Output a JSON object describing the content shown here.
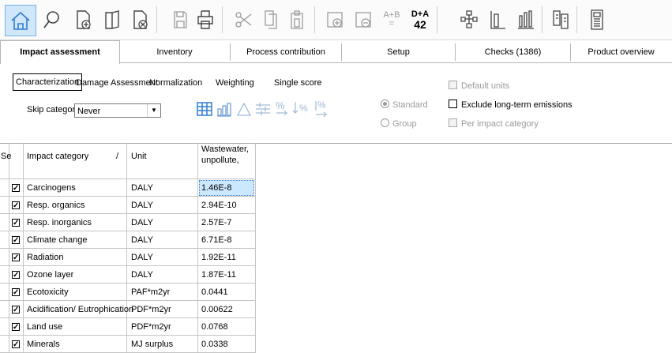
{
  "toolbar": {
    "buttons": [
      {
        "name": "home-icon",
        "active": true
      },
      {
        "name": "search-icon"
      },
      {
        "name": "new-document-icon"
      },
      {
        "name": "open-book-icon"
      },
      {
        "name": "delete-document-icon"
      },
      {
        "name": "save-icon"
      },
      {
        "name": "print-icon"
      },
      {
        "name": "cut-icon"
      },
      {
        "name": "copy-icon"
      },
      {
        "name": "paste-icon"
      },
      {
        "name": "add-icon"
      },
      {
        "name": "remove-icon"
      },
      {
        "name": "a-plus-b-icon",
        "text_top": "A+B",
        "text_bottom": "="
      },
      {
        "name": "d-plus-a-icon",
        "text_top": "D+A",
        "text_bottom": "42"
      },
      {
        "name": "network-icon"
      },
      {
        "name": "single-bar-icon"
      },
      {
        "name": "bar-chart-icon"
      },
      {
        "name": "compare-documents-icon"
      },
      {
        "name": "calculator-icon"
      }
    ]
  },
  "tabs": [
    {
      "label": "Impact assessment",
      "active": true
    },
    {
      "label": "Inventory"
    },
    {
      "label": "Process contribution"
    },
    {
      "label": "Setup"
    },
    {
      "label": "Checks (1386)"
    },
    {
      "label": "Product overview"
    }
  ],
  "subtabs": [
    {
      "label": "Characterization",
      "active": true
    },
    {
      "label": "Damage Assessment"
    },
    {
      "label": "Normalization"
    },
    {
      "label": "Weighting"
    },
    {
      "label": "Single score"
    }
  ],
  "skip": {
    "label": "Skip categories",
    "value": "Never"
  },
  "view_icons": [
    "table-icon",
    "bar-chart-icon",
    "triangle-icon",
    "filter-icon",
    "percent-icon",
    "sort-percent-icon",
    "percent-arrow-icon"
  ],
  "mode": {
    "standard": "Standard",
    "group": "Group",
    "selected": "standard"
  },
  "options": {
    "default_units": "Default units",
    "exclude_longterm": "Exclude long-term emissions",
    "per_impact": "Per impact category"
  },
  "table": {
    "headers": {
      "sel": "Se",
      "category": "Impact category",
      "sort_mark": "/",
      "unit": "Unit",
      "col1_line1": "Wastewater,",
      "col1_line2": "unpollute,"
    },
    "rows": [
      {
        "category": "Carcinogens",
        "unit": "DALY",
        "value": "1.46E-8",
        "checked": true
      },
      {
        "category": "Resp. organics",
        "unit": "DALY",
        "value": "2.94E-10",
        "checked": true
      },
      {
        "category": "Resp. inorganics",
        "unit": "DALY",
        "value": "2.57E-7",
        "checked": true
      },
      {
        "category": "Climate change",
        "unit": "DALY",
        "value": "6.71E-8",
        "checked": true
      },
      {
        "category": "Radiation",
        "unit": "DALY",
        "value": "1.92E-11",
        "checked": true
      },
      {
        "category": "Ozone layer",
        "unit": "DALY",
        "value": "1.87E-11",
        "checked": true
      },
      {
        "category": "Ecotoxicity",
        "unit": "PAF*m2yr",
        "value": "0.0441",
        "checked": true
      },
      {
        "category": "Acidification/ Eutrophication",
        "unit": "PDF*m2yr",
        "value": "0.00622",
        "checked": true
      },
      {
        "category": "Land use",
        "unit": "PDF*m2yr",
        "value": "0.0768",
        "checked": true
      },
      {
        "category": "Minerals",
        "unit": "MJ surplus",
        "value": "0.0338",
        "checked": true
      }
    ]
  },
  "colors": {
    "accent": "#2f7dd1",
    "selected_cell": "#cce8ff",
    "disabled": "#9a9a9a"
  }
}
